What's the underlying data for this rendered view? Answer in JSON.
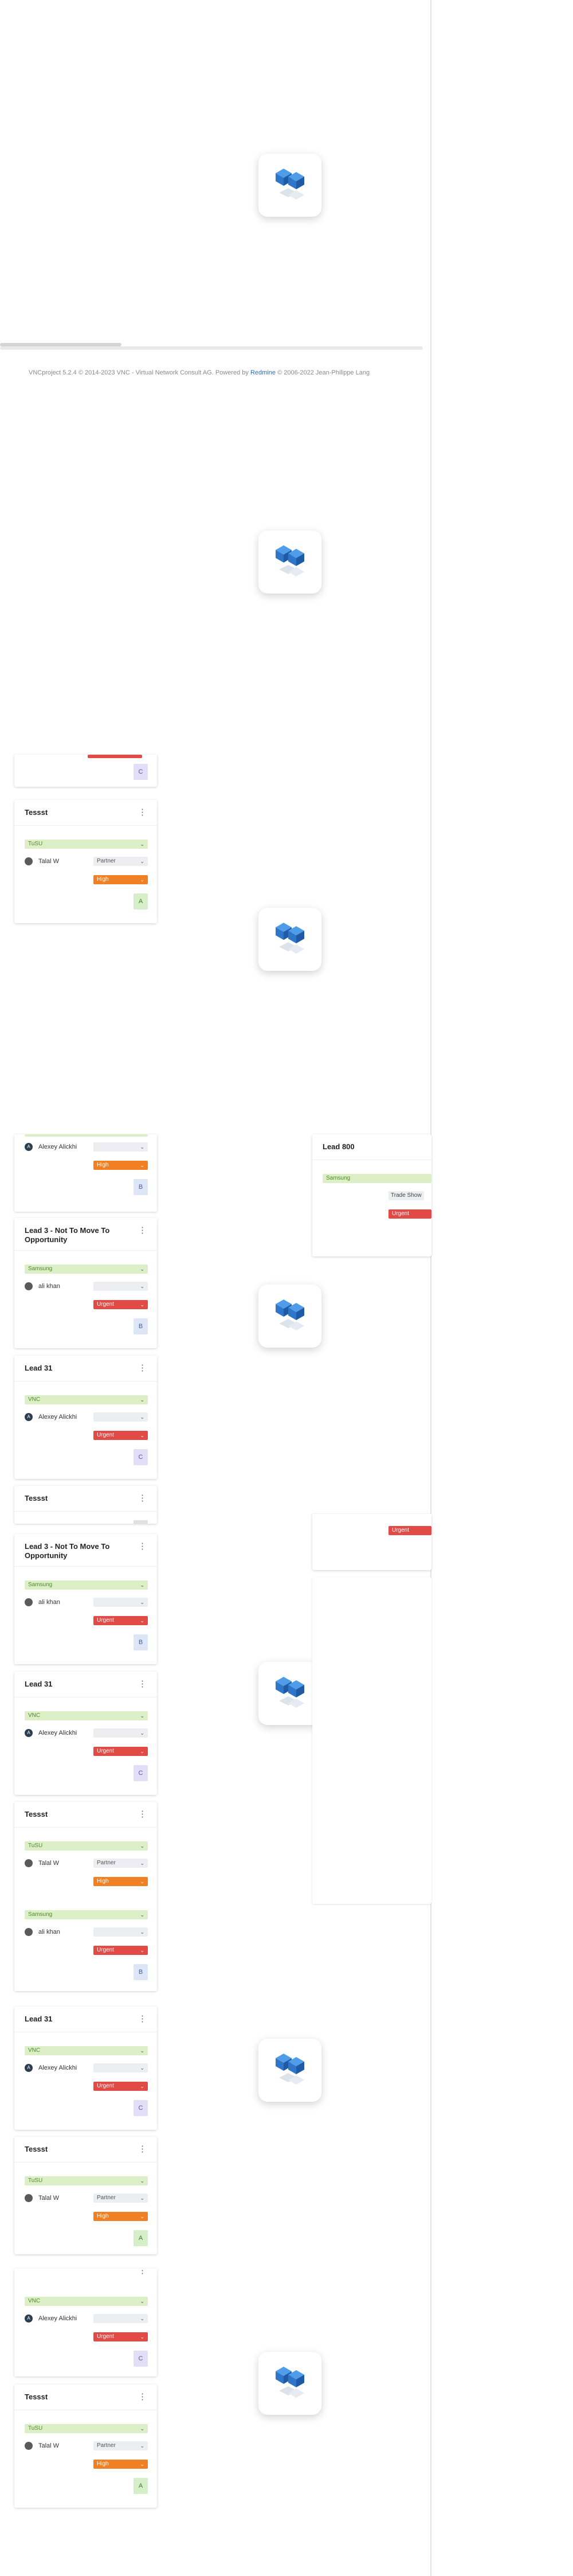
{
  "footer": {
    "prefix": "VNCproject 5.2.4 © 2014-2023 VNC - Virtual Network Consult AG. Powered by ",
    "link": "Redmine",
    "suffix": " © 2006-2022 Jean-Philippe Lang"
  },
  "colors": {
    "company": "#dcefc6",
    "urgent": "#e24a45",
    "high": "#f08023",
    "grade_a": "#d6efc8",
    "grade_b": "#dce6f6",
    "grade_c": "#e3def7"
  },
  "icons": {
    "loader": "vnc-cube-logo",
    "menu": "vertical-dots-icon",
    "dropdown": "chevron-down-icon"
  },
  "cards": [
    {
      "title": "",
      "priority": "",
      "grade": "C"
    },
    {
      "title": "Tessst",
      "company": "TuSU",
      "owner": "Talal W",
      "role": "Partner",
      "priority": "High",
      "grade": "A"
    },
    {
      "title": "",
      "owner": "Alexey Alickhi",
      "role": "",
      "priority": "High",
      "grade": "B"
    },
    {
      "title": "Lead 3 - Not To Move To Opportunity",
      "company": "Samsung",
      "owner": "ali khan",
      "role": "",
      "priority": "Urgent",
      "grade": "B"
    },
    {
      "title": "Lead 31",
      "company": "VNC",
      "owner": "Alexey Alickhi",
      "role": "",
      "priority": "Urgent",
      "grade": "C"
    },
    {
      "title": "Tessst"
    },
    {
      "title": "Lead 3 - Not To Move To Opportunity",
      "company": "Samsung",
      "owner": "ali khan",
      "role": "",
      "priority": "Urgent",
      "grade": "B"
    },
    {
      "title": "Lead 31",
      "company": "VNC",
      "owner": "Alexey Alickhi",
      "role": "",
      "priority": "Urgent",
      "grade": "C"
    },
    {
      "title": "Tessst",
      "company": "TuSU",
      "owner": "Talal W",
      "role": "Partner",
      "priority": "High",
      "company2": "Samsung",
      "owner2": "ali khan",
      "priority2": "Urgent",
      "grade": "B"
    },
    {
      "title": "Lead 31",
      "company": "VNC",
      "owner": "Alexey Alickhi",
      "role": "",
      "priority": "Urgent",
      "grade": "C"
    },
    {
      "title": "Tessst",
      "company": "TuSU",
      "owner": "Talal W",
      "role": "Partner",
      "priority": "High",
      "grade": "A"
    },
    {
      "title": "",
      "company": "VNC",
      "owner": "Alexey Alickhi",
      "role": "",
      "priority": "Urgent",
      "grade": "C"
    },
    {
      "title": "Tessst",
      "company": "TuSU",
      "owner": "Talal W",
      "role": "Partner",
      "priority": "High",
      "grade": "A"
    }
  ],
  "right_cards": [
    {
      "title": "Lead 800",
      "company": "Samsung",
      "source": "Trade Show",
      "priority": "Urgent"
    },
    {
      "priority": "Urgent"
    }
  ]
}
